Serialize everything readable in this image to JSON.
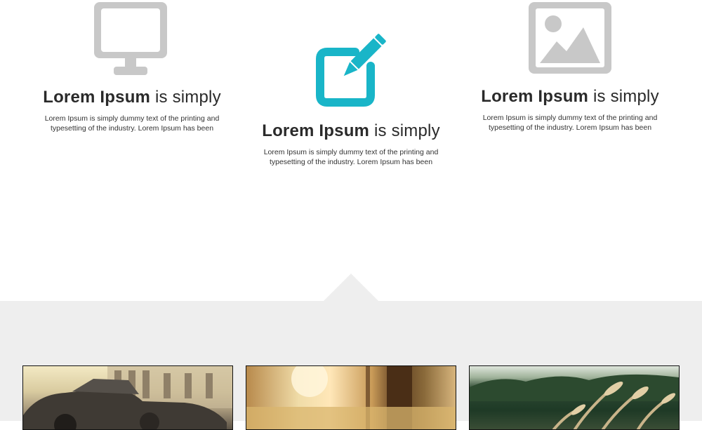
{
  "features": [
    {
      "title_bold": "Lorem Ipsum",
      "title_rest": " is simply",
      "text": "Lorem Ipsum is simply dummy text of the printing and typesetting of the industry. Lorem Ipsum has been",
      "icon": "monitor-icon",
      "icon_color": "#c8c8c8"
    },
    {
      "title_bold": "Lorem Ipsum",
      "title_rest": " is simply",
      "text": "Lorem Ipsum is simply dummy text of the printing and typesetting of the industry. Lorem Ipsum has been",
      "icon": "edit-icon",
      "icon_color": "#19b5c8"
    },
    {
      "title_bold": "Lorem Ipsum",
      "title_rest": " is simply",
      "text": "Lorem Ipsum is simply dummy text of the printing and typesetting of the industry. Lorem Ipsum has been",
      "icon": "image-icon",
      "icon_color": "#c8c8c8"
    }
  ],
  "gallery": {
    "background_color": "#eeeeee",
    "thumbnails": [
      "vintage-car-photo",
      "sunlit-forest-photo",
      "wheat-field-photo"
    ]
  }
}
